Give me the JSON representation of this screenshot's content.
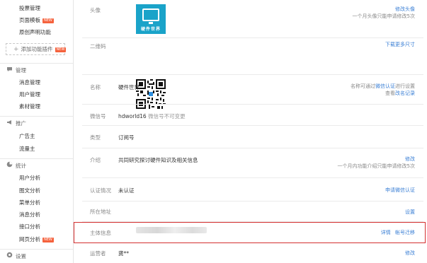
{
  "sidebar": {
    "top_items": [
      {
        "label": "投票管理"
      },
      {
        "label": "页面模板",
        "badge": "NEW"
      },
      {
        "label": "原创声明功能"
      }
    ],
    "add_plugin": {
      "label": "添加功能插件",
      "badge": "NEW"
    },
    "sections": [
      {
        "title": "管理",
        "icon": "speech-bubble-icon",
        "items": [
          {
            "label": "消息管理"
          },
          {
            "label": "用户管理"
          },
          {
            "label": "素材管理"
          }
        ]
      },
      {
        "title": "推广",
        "icon": "megaphone-icon",
        "items": [
          {
            "label": "广告主"
          },
          {
            "label": "流量主"
          }
        ]
      },
      {
        "title": "统计",
        "icon": "pie-chart-icon",
        "items": [
          {
            "label": "用户分析"
          },
          {
            "label": "图文分析"
          },
          {
            "label": "菜单分析"
          },
          {
            "label": "消息分析"
          },
          {
            "label": "接口分析"
          },
          {
            "label": "网页分析",
            "badge": "NEW"
          }
        ]
      },
      {
        "title": "设置",
        "icon": "gear-icon",
        "items": []
      }
    ]
  },
  "account": {
    "avatar": {
      "label": "头像",
      "brand_text": "硬件世界",
      "action": "修改头像",
      "note": "一个月头像只能申请修改5次"
    },
    "qrcode": {
      "label": "二维码",
      "action": "下载更多尺寸"
    },
    "name": {
      "label": "名称",
      "value": "硬件世界",
      "note_prefix": "名称可通过",
      "note_link": "微信认证",
      "note_suffix": "进行设置",
      "note_line2_prefix": "查看",
      "note_line2_link": "改名记录"
    },
    "wechat_id": {
      "label": "微信号",
      "value": "hdworld16",
      "value_note": "微信号不可变更"
    },
    "type": {
      "label": "类型",
      "value": "订阅号"
    },
    "intro": {
      "label": "介绍",
      "value": "共同研究探讨硬件知识及相关信息",
      "action": "修改",
      "note": "一个月内功能介绍只能申请修改5次"
    },
    "verification": {
      "label": "认证情况",
      "value": "未认证",
      "action": "申请微信认证"
    },
    "address": {
      "label": "所在地址",
      "action": "设置"
    },
    "entity": {
      "label": "主体信息",
      "action1": "详情",
      "action2": "帐号迁移"
    },
    "operator": {
      "label": "运营者",
      "value": "龚**",
      "action": "修改"
    }
  },
  "colors": {
    "link": "#3a7fd5",
    "highlight": "#d42f2f",
    "badge": "#f5623d",
    "avatar_bg": "#1aa3c9"
  }
}
